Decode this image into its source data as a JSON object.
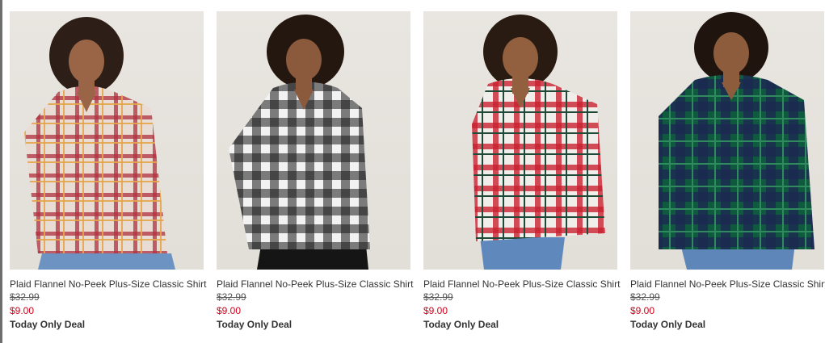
{
  "products": [
    {
      "name": "Plaid Flannel No-Peek Plus-Size Classic Shirt",
      "original_price": "$32.99",
      "sale_price": "$9.00",
      "deal": "Today Only Deal",
      "shirt_colors": {
        "base": "#e9dcd5",
        "stripe": "#b0303d",
        "accent": "#e5a54a"
      },
      "bottom_color": "#6d93c2"
    },
    {
      "name": "Plaid Flannel No-Peek Plus-Size Classic Shirt",
      "original_price": "$32.99",
      "sale_price": "$9.00",
      "deal": "Today Only Deal",
      "shirt_colors": {
        "base": "#f2f2f2",
        "stripe": "#1a1a1a",
        "accent": "#777777"
      },
      "bottom_color": "#151515"
    },
    {
      "name": "Plaid Flannel No-Peek Plus-Size Classic Shirt",
      "original_price": "$32.99",
      "sale_price": "$9.00",
      "deal": "Today Only Deal",
      "shirt_colors": {
        "base": "#efeeea",
        "stripe": "#c8222f",
        "accent": "#1f4a37"
      },
      "bottom_color": "#5f88bd"
    },
    {
      "name": "Plaid Flannel No-Peek Plus-Size Classic Shirt",
      "original_price": "$32.99",
      "sale_price": "$9.00",
      "deal": "Today Only Deal",
      "shirt_colors": {
        "base": "#0f5a3f",
        "stripe": "#1b2850",
        "accent": "#2f8a5d"
      },
      "bottom_color": "#5f86b8"
    }
  ]
}
